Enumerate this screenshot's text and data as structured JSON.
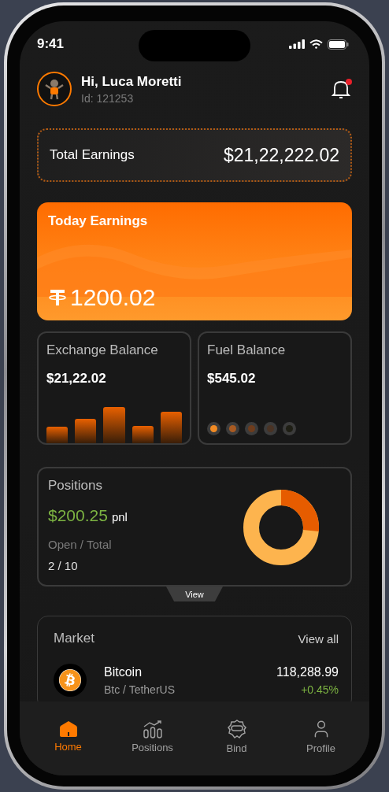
{
  "status_bar": {
    "time": "9:41"
  },
  "header": {
    "greeting": "Hi, Luca Moretti",
    "user_id": "Id: 121253",
    "notification_unread": true
  },
  "total_earnings": {
    "label": "Total Earnings",
    "amount": "$21,22,222.02"
  },
  "today_earnings": {
    "label": "Today Earnings",
    "amount": "1200.02"
  },
  "exchange_balance": {
    "label": "Exchange Balance",
    "amount": "$21,22.02"
  },
  "fuel_balance": {
    "label": "Fuel Balance",
    "amount": "$545.02",
    "dots": [
      {
        "color": "#f08a24"
      },
      {
        "color": "#a85a22"
      },
      {
        "color": "#6e3c1c"
      },
      {
        "color": "#4a3324"
      },
      {
        "color": "#1e1e14"
      }
    ]
  },
  "positions": {
    "title": "Positions",
    "pnl": "$200.25",
    "pnl_unit": "pnl",
    "open_total_label": "Open / Total",
    "open_total": "2 / 10",
    "view_button": "View"
  },
  "market": {
    "title": "Market",
    "view_all": "View all",
    "rows": [
      {
        "name": "Bitcoin",
        "pair": "Btc / TetherUS",
        "price": "118,288.99",
        "change": "+0.45%"
      }
    ]
  },
  "nav": [
    {
      "label": "Home",
      "kind": "home",
      "selected": true
    },
    {
      "label": "Positions",
      "kind": "chart",
      "selected": false
    },
    {
      "label": "Bind",
      "kind": "api",
      "selected": false
    },
    {
      "label": "Profile",
      "kind": "user",
      "selected": false
    }
  ]
}
